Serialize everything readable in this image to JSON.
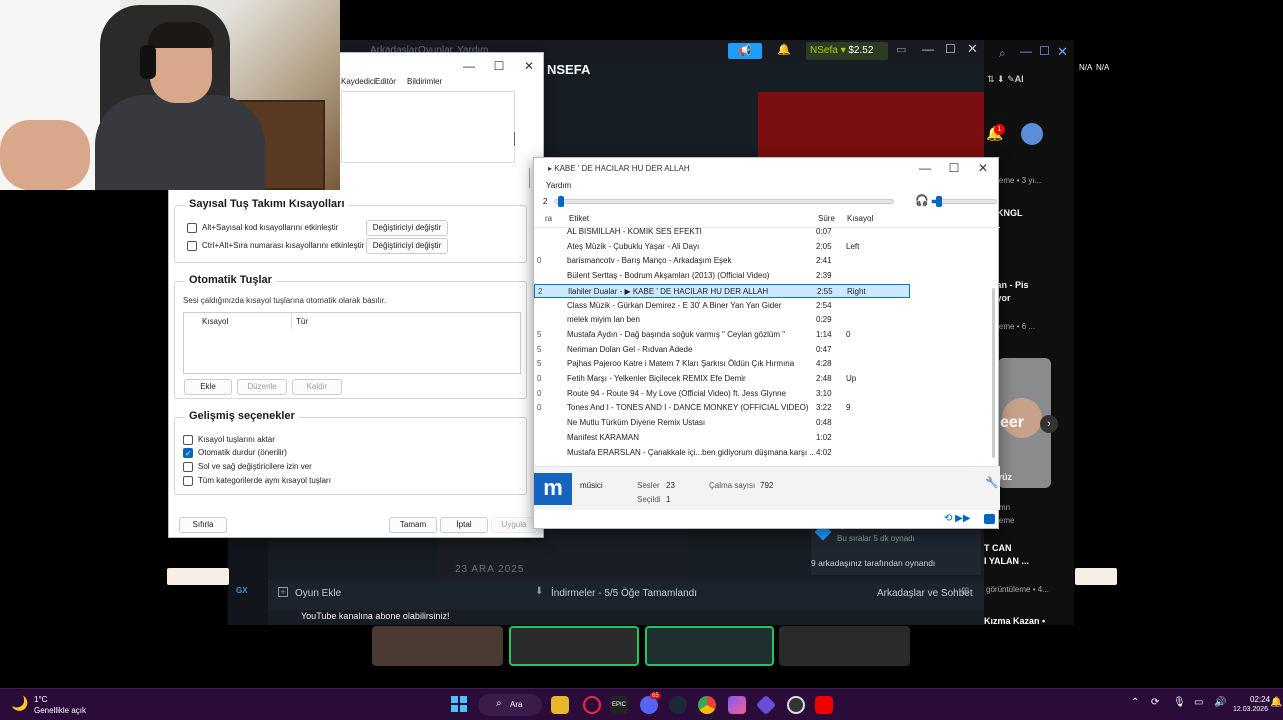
{
  "steam": {
    "menu": [
      "Arkadaşlar",
      "Oyunlar",
      "Yardım"
    ],
    "profile_name": "NSEFA",
    "user": "NSefa",
    "balance": "$2.52",
    "date_label": "23 ARA 2025",
    "friends_online_line1": "Bu sıralar 5 dk oynadı",
    "friends_played": "9 arkadaşınız tarafından oynandı",
    "add_game": "Oyun Ekle",
    "downloads": "İndirmeler - 5/5 Öğe Tamamlandı",
    "friends_chat": "Arkadaşlar ve Sohbet"
  },
  "youtube": {
    "na1": "N/A",
    "na2": "N/A",
    "ai": "AI",
    "badge": "1",
    "items": [
      "ütüleme • 3 yı...",
      "| KNGL",
      "zan - Pis",
      "kuyor",
      "ütüleme • 6 ...",
      "eer",
      "an yüz",
      "ah",
      "mn",
      "ütüleme",
      "T CAN",
      "I YALAN ...",
      "görüntüleme • 4...",
      "Kızma Kazan •"
    ],
    "subscribe_hint": "YouTube kanalına abone olabilirsiniz!"
  },
  "settings": {
    "tabs": [
      "Kaydedici",
      "Editör",
      "Bildirimler"
    ],
    "numpad_title": "Sayısal Tuş Takımı Kısayolları",
    "numpad_opt1": "Alt+Sayısal kod kısayollarını etkinleştir",
    "numpad_opt2": "Ctrl+Alt+Sıra numarası kısayollarını etkinleştir",
    "change_modifier": "Değiştiriciyi değiştir",
    "auto_title": "Otomatik Tuşlar",
    "auto_desc": "Sesi çaldığınızda kısayol tuşlarına otomatik olarak basılır.",
    "col_shortcut": "Kısayol",
    "col_type": "Tür",
    "btn_add": "Ekle",
    "btn_edit": "Düzenle",
    "btn_delete": "Kaldır",
    "adv_title": "Gelişmiş seçenekler",
    "adv_opts": [
      "Kısayol tuşlarını aktar",
      "Otomatik durdur (önerilir)",
      "Sol ve sağ değiştiricilere izin ver",
      "Tüm kategorilerde aynı kısayol tuşları"
    ],
    "adv_checked": [
      false,
      true,
      false,
      false
    ],
    "btn_reset": "Sıfırla",
    "btn_ok": "Tamam",
    "btn_cancel": "İptal",
    "btn_apply": "Uygula"
  },
  "player": {
    "title": "KABE ' DE HACILAR HU DER ALLAH",
    "menu": "Yardım",
    "col_label": "Etiket",
    "col_duration": "Süre",
    "col_key": "Kısayol",
    "rows": [
      {
        "n": "",
        "t": "AL BISMILLAH - KOMIK SES EFEKTI",
        "d": "0:07",
        "k": ""
      },
      {
        "n": "",
        "t": "Ateş Müzik - Çubuklu Yaşar - Ali Dayı",
        "d": "2:05",
        "k": "Left"
      },
      {
        "n": "0",
        "t": "barismancotv - Barış Manço - Arkadaşım Eşek",
        "d": "2:41",
        "k": ""
      },
      {
        "n": "",
        "t": "Bülent Serttaş - Bodrum Akşamları (2013) (Official Video)",
        "d": "2:39",
        "k": ""
      },
      {
        "n": "2",
        "t": "Ilahiler Dualar - ▶ KABE ' DE HACILAR HU DER ALLAH",
        "d": "2:55",
        "k": "Right"
      },
      {
        "n": "",
        "t": "Class Müzik - Gürkan Demirez - E 30' A Biner Yan Yan Gider",
        "d": "2:54",
        "k": ""
      },
      {
        "n": "",
        "t": "melek miyim lan ben",
        "d": "0:29",
        "k": ""
      },
      {
        "n": "5",
        "t": "Mustafa Aydın - Dağ başında soğuk varmış \" Ceylan gözlüm \"",
        "d": "1:14",
        "k": "0"
      },
      {
        "n": "5",
        "t": "Neriman Dolan Gel - Rıdvan Adede",
        "d": "0:47",
        "k": ""
      },
      {
        "n": "5",
        "t": "Pajhas Pajeroo  Katre i Matem 7 Kları Şarkısı Öldün Çık Hırmına",
        "d": "4:28",
        "k": ""
      },
      {
        "n": "0",
        "t": "Fetih Marşı - Yelkenler Biçilecek  REMIX  Efe Demir",
        "d": "2:48",
        "k": "Up"
      },
      {
        "n": "0",
        "t": "Route 94 - Route 94 - My Love (Official Video) ft. Jess Glynne",
        "d": "3:10",
        "k": ""
      },
      {
        "n": "0",
        "t": "Tones And I - TONES AND I - DANCE MONKEY (OFFICIAL VIDEO)",
        "d": "3:22",
        "k": "9"
      },
      {
        "n": "",
        "t": "Ne Mutlu Türküm Diyene   Remix Ustası",
        "d": "0:48",
        "k": ""
      },
      {
        "n": "",
        "t": "Manifest KARAMAN",
        "d": "1:02",
        "k": ""
      },
      {
        "n": "",
        "t": "Mustafa ERARSLAN - Çanakkale içi...ben gidiyorum düşmana karşı ...",
        "d": "4:02",
        "k": ""
      }
    ],
    "category": "müsici",
    "sounds_label": "Sesler",
    "sounds_value": "23",
    "play_label": "Çalma sayısı",
    "play_value": "792",
    "selected_label": "Seçildi",
    "selected_value": "1",
    "logo": "m",
    "num_fragment": "2"
  },
  "gx": {
    "label": "GX"
  },
  "taskbar": {
    "temp": "1°C",
    "weather": "Genellikle açık",
    "search": "Ara",
    "time": "02:24",
    "date": "12.03.2026",
    "discord_badge": "65"
  }
}
